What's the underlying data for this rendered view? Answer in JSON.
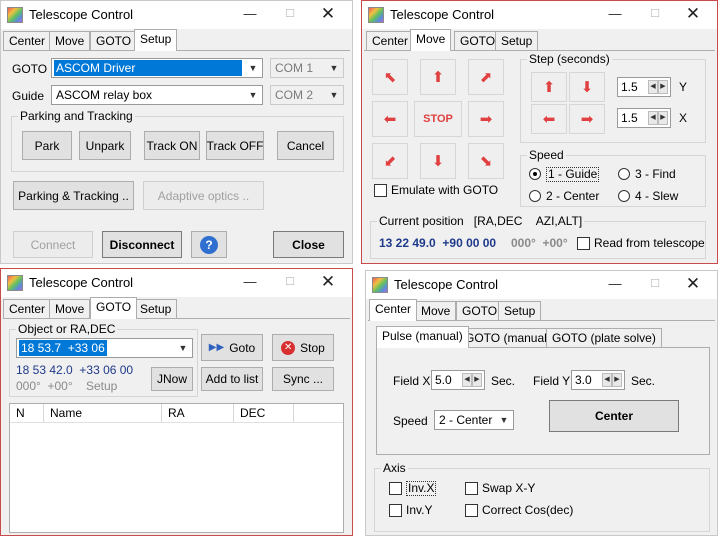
{
  "window_title": "Telescope Control",
  "titlebar": {
    "minimize": "—",
    "maximize": "☐",
    "close": "✕"
  },
  "tabs": {
    "center": "Center",
    "move": "Move",
    "goto": "GOTO",
    "setup": "Setup"
  },
  "setup": {
    "goto_label": "GOTO",
    "goto_driver": "ASCOM Driver",
    "goto_port": "COM 1",
    "guide_label": "Guide",
    "guide_driver": "ASCOM relay box",
    "guide_port": "COM 2",
    "parking_group": "Parking and Tracking",
    "park": "Park",
    "unpark": "Unpark",
    "track_on": "Track ON",
    "track_off": "Track OFF",
    "cancel": "Cancel",
    "parking_tracking": "Parking & Tracking ..",
    "adaptive_optics": "Adaptive optics ..",
    "connect": "Connect",
    "disconnect": "Disconnect",
    "help": "?",
    "close": "Close"
  },
  "move": {
    "stop": "STOP",
    "step_group": "Step (seconds)",
    "step_y": "1.5",
    "y_label": "Y",
    "step_x": "1.5",
    "x_label": "X",
    "speed_group": "Speed",
    "speed_1": "1 - Guide",
    "speed_2": "2 - Center",
    "speed_3": "3 - Find",
    "speed_4": "4 - Slew",
    "speed_selected": "1 - Guide",
    "emulate": "Emulate with GOTO",
    "position_group": "Current position",
    "radec_label": "[RA,DEC",
    "azalt_label": "AZI,ALT]",
    "ra_dec_value": "13 22 49.0  +90 00 00",
    "az_alt_value": "000°  +00°",
    "read_from_telescope": "Read from telescope"
  },
  "goto": {
    "object_group": "Object or RA,DEC",
    "object_value": "18 53.7  +33 06",
    "goto_btn": "Goto",
    "stop_btn": "Stop",
    "coords": "18 53 42.0  +33 06 00",
    "altaz": "000°  +00°",
    "setup_hint": "Setup",
    "jnow": "JNow",
    "add_to_list": "Add to list",
    "sync": "Sync ...",
    "columns": [
      "N",
      "Name",
      "RA",
      "DEC"
    ]
  },
  "center": {
    "subtabs": [
      "Pulse (manual)",
      "GOTO (manual)",
      "GOTO (plate solve)"
    ],
    "field_x_label": "Field X",
    "field_x": "5.0",
    "sec": "Sec.",
    "field_y_label": "Field Y",
    "field_y": "3.0",
    "speed_label": "Speed",
    "speed_value": "2 - Center",
    "center_btn": "Center",
    "axis_group": "Axis",
    "inv_x": "Inv.X",
    "inv_y": "Inv.Y",
    "swap_xy": "Swap X-Y",
    "correct_cos": "Correct Cos(dec)"
  },
  "colors": {
    "accent": "#0078d7",
    "arrow": "#e04040",
    "coords_blue": "#1f3a8a",
    "red_border": "#c84a4a"
  }
}
